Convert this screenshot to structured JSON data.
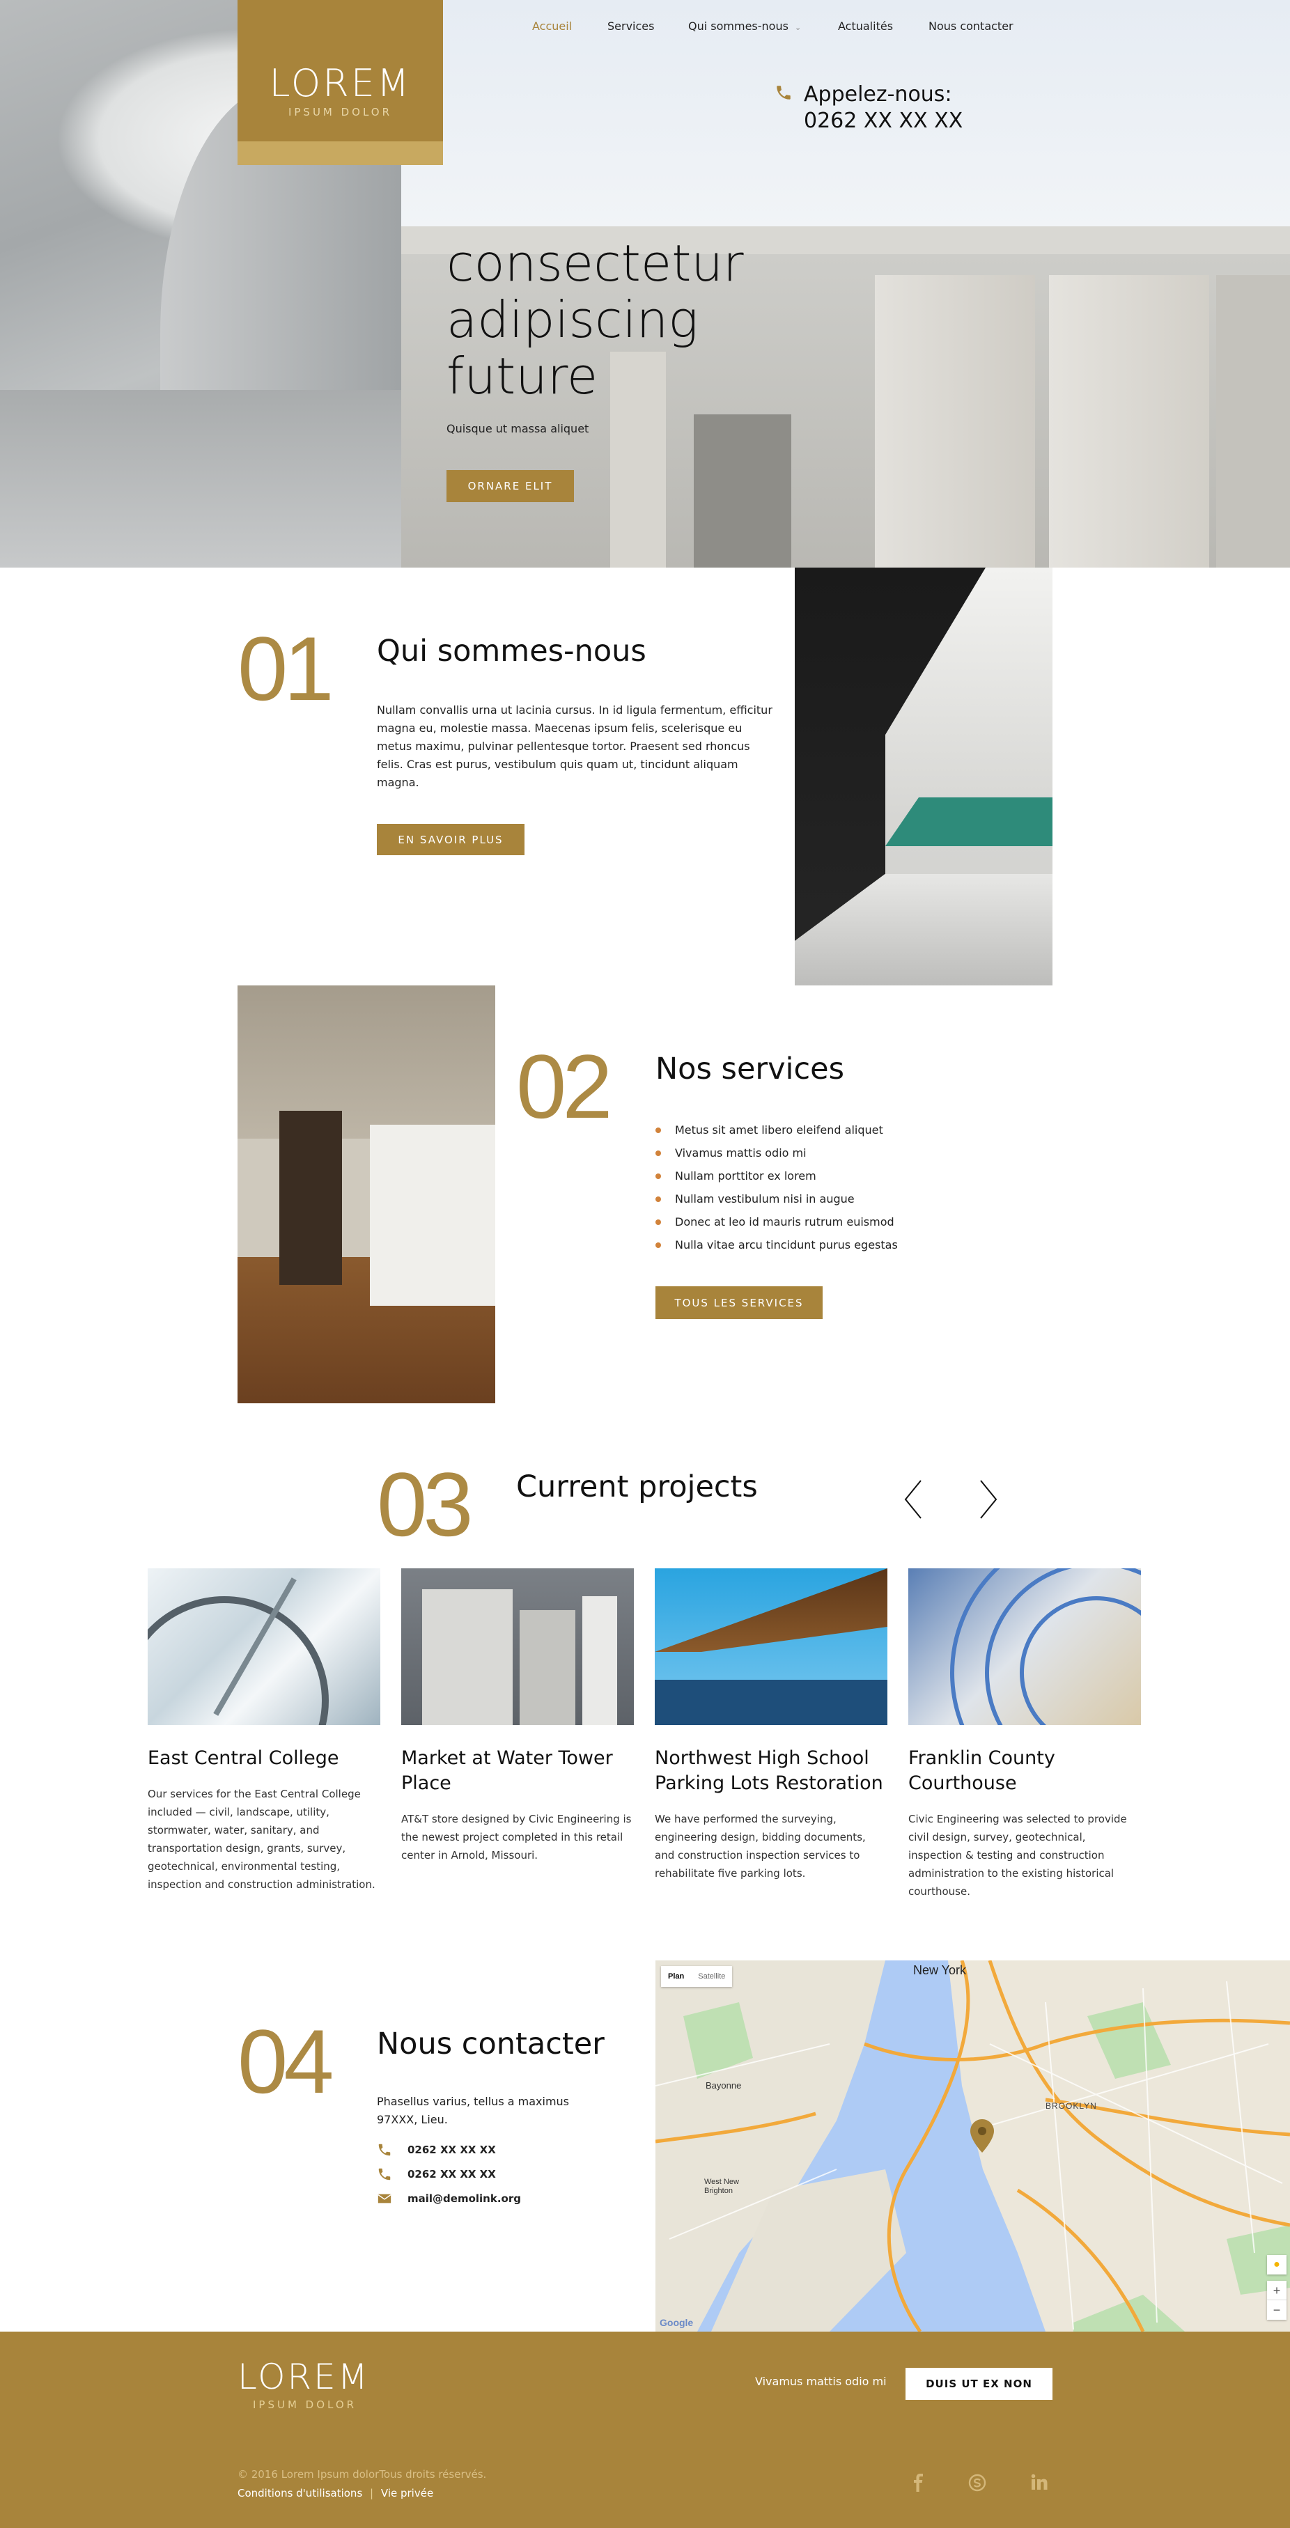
{
  "brand": {
    "name": "LOREM",
    "tagline": "IPSUM DOLOR"
  },
  "nav": {
    "items": [
      "Accueil",
      "Services",
      "Qui sommes-nous",
      "Actualités",
      "Nous contacter"
    ],
    "active": "Accueil"
  },
  "header": {
    "phone_label": "Appelez-nous:",
    "phone": "0262 XX XX XX"
  },
  "hero": {
    "title_lines": [
      "consectetur",
      "adipiscing",
      "future"
    ],
    "subtitle": "Quisque ut massa aliquet",
    "button": "ORNARE ELIT"
  },
  "about": {
    "number": "01",
    "title": "Qui sommes-nous",
    "text": "Nullam convallis urna ut lacinia cursus. In id ligula fermentum, efficitur magna eu, molestie massa. Maecenas ipsum felis, scelerisque eu metus maximu, pulvinar pellentesque tortor. Praesent sed rhoncus felis. Cras est purus, vestibulum quis quam ut, tincidunt aliquam magna.",
    "button": "EN SAVOIR PLUS"
  },
  "services": {
    "number": "02",
    "title": "Nos services",
    "items": [
      "Metus sit amet libero eleifend aliquet",
      "Vivamus mattis odio mi",
      "Nullam porttitor ex lorem",
      "Nullam vestibulum nisi in augue",
      "Donec at leo id mauris rutrum euismod",
      "Nulla vitae arcu tincidunt purus egestas"
    ],
    "button": "TOUS LES SERVICES"
  },
  "projects": {
    "number": "03",
    "title": "Current projects",
    "items": [
      {
        "title": "East Central College",
        "desc": "Our services for the East Central College included — civil, landscape, utility, stormwater, water, sanitary, and transportation design, grants, survey, geotechnical, environmental testing, inspection and construction administration."
      },
      {
        "title": "Market at Water Tower Place",
        "desc": "AT&T store designed by Civic Engineering is the newest project completed in this retail center in Arnold, Missouri."
      },
      {
        "title": "Northwest High School Parking Lots Restoration",
        "desc": "We have performed the surveying, engineering design, bidding documents, and construction inspection services to rehabilitate five parking lots."
      },
      {
        "title": "Franklin County Courthouse",
        "desc": "Civic Engineering was selected to provide civil design, survey, geotechnical, inspection & testing and construction administration to the existing historical courthouse."
      }
    ]
  },
  "contact": {
    "number": "04",
    "title": "Nous contacter",
    "address": "Phasellus varius, tellus a maximus 97XXX, Lieu.",
    "phone1": "0262 XX XX XX",
    "phone2": "0262 XX XX XX",
    "email": "mail@demolink.org"
  },
  "map": {
    "tab_plan": "Plan",
    "tab_satellite": "Satellite",
    "labels": [
      "New York",
      "Bayonne",
      "BROOKLYN",
      "West New Brighton",
      "Google"
    ],
    "zoom_in": "+",
    "zoom_out": "−"
  },
  "footer": {
    "newsletter_text": "Vivamus mattis odio mi",
    "newsletter_button": "DUIS UT EX NON",
    "copyright": "© 2016 Lorem Ipsum dolorTous droits réservés.",
    "terms": "Conditions d'utilisations",
    "separator": "|",
    "privacy": "Vie privée",
    "social": [
      "facebook-icon",
      "skype-icon",
      "linkedin-icon"
    ]
  },
  "colors": {
    "accent": "#a8843b",
    "footer_bg": "#a8843b",
    "bullet": "#d1823a"
  }
}
